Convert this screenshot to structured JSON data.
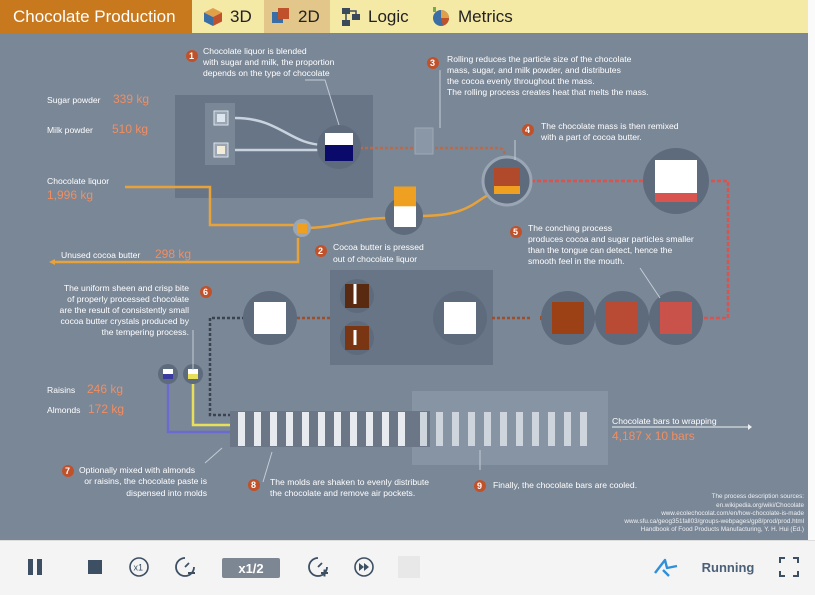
{
  "app": {
    "tabs": [
      {
        "label": "Chocolate Production",
        "icon": "none"
      },
      {
        "label": "3D",
        "icon": "cube-icon"
      },
      {
        "label": "2D",
        "icon": "2d-shapes-icon"
      },
      {
        "label": "Logic",
        "icon": "flowchart-icon"
      },
      {
        "label": "Metrics",
        "icon": "pie-chart-icon"
      }
    ],
    "active_tab": "2D"
  },
  "inputs": {
    "sugar": {
      "label": "Sugar powder",
      "value": "339 kg"
    },
    "milk": {
      "label": "Milk powder",
      "value": "510 kg"
    },
    "liquor": {
      "label": "Chocolate liquor",
      "value": "1,996 kg"
    },
    "butter": {
      "label": "Unused cocoa butter",
      "value": "298 kg"
    },
    "raisins": {
      "label": "Raisins",
      "value": "246 kg"
    },
    "almonds": {
      "label": "Almonds",
      "value": "172 kg"
    },
    "output": {
      "label": "Chocolate bars to wrapping",
      "value": "4,187 x 10 bars"
    }
  },
  "steps": [
    {
      "num": "1",
      "lines": [
        "Chocolate liquor is blended",
        "with sugar and milk, the proportion",
        "depends on the type of chocolate"
      ]
    },
    {
      "num": "2",
      "lines": [
        "Cocoa butter is pressed",
        "out of chocolate liquor"
      ]
    },
    {
      "num": "3",
      "lines": [
        "Rolling reduces the particle size of the chocolate",
        "mass, sugar, and milk powder,  and distributes",
        "the cocoa  evenly throughout the mass.",
        "The rolling process creates heat that melts the mass."
      ]
    },
    {
      "num": "4",
      "lines": [
        "The chocolate mass is then remixed",
        "with a part of cocoa butter."
      ]
    },
    {
      "num": "5",
      "lines": [
        "The conching process",
        "produces cocoa and sugar particles smaller",
        "than the tongue can detect, hence the",
        "smooth feel in the mouth."
      ]
    },
    {
      "num": "6",
      "lines": [
        "The uniform sheen and crisp bite",
        "of properly processed chocolate",
        "are the result of consistently small",
        "cocoa butter crystals produced by",
        "the tempering process."
      ]
    },
    {
      "num": "7",
      "lines": [
        "Optionally mixed with almonds",
        "or raisins, the chocolate paste is",
        "dispensed into molds"
      ]
    },
    {
      "num": "8",
      "lines": [
        "The molds are shaken to evenly distribute",
        "the chocolate and remove air pockets."
      ]
    },
    {
      "num": "9",
      "lines": [
        "Finally, the chocolate bars are cooled."
      ]
    }
  ],
  "sources": [
    "The process description sources:",
    "en.wikipedia.org/wiki/Chocolate",
    "www.ecolechocolat.com/en/how-chocolate-is-made",
    "www.sfu.ca/geog351fall03/groups-webpages/gp8/prod/prod.html",
    "Handbook of Food Products Manufacturing, Y. H. Hui (Ed.)"
  ],
  "controls": {
    "speed": "x1/2",
    "status": "Running",
    "buttons": [
      "pause-icon",
      "stop-icon",
      "realtime-x1-icon",
      "slower-icon",
      "faster-icon",
      "fast-forward-icon",
      "blank-button",
      "run-logo-icon",
      "fullscreen-icon"
    ]
  },
  "colors": {
    "title_tab": "#c8791e",
    "top_bar": "#f5e9a6",
    "canvas": "#7a8797",
    "value_text": "#f28e60",
    "step_badge": "#c0522b",
    "pipe_orange": "#e8a23a",
    "pipe_red": "#d9534f"
  }
}
